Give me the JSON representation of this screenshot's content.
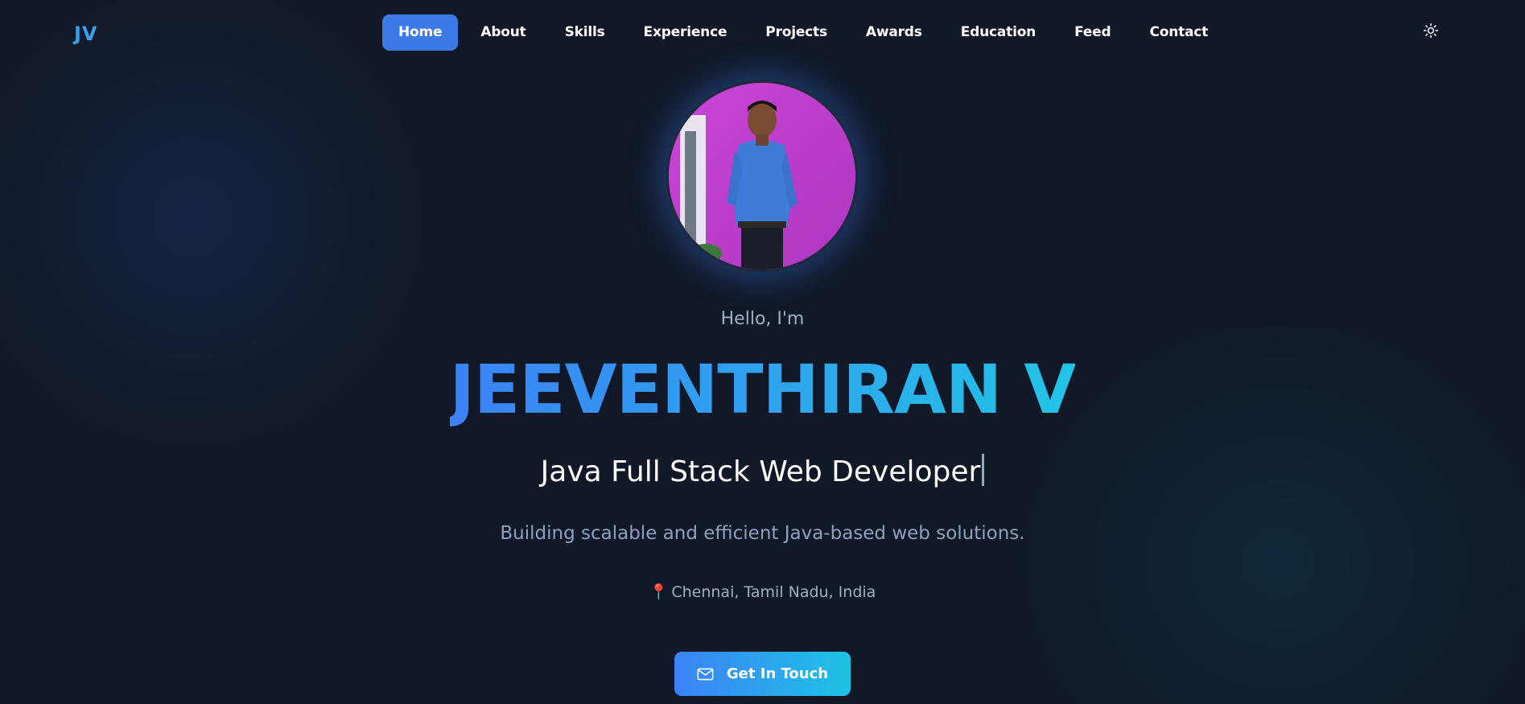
{
  "nav": {
    "logo": "JV",
    "items": [
      {
        "label": "Home",
        "active": true
      },
      {
        "label": "About"
      },
      {
        "label": "Skills"
      },
      {
        "label": "Experience"
      },
      {
        "label": "Projects"
      },
      {
        "label": "Awards"
      },
      {
        "label": "Education"
      },
      {
        "label": "Feed"
      },
      {
        "label": "Contact"
      }
    ],
    "theme_icon": "sun-icon"
  },
  "hero": {
    "avatar_icon": "profile-photo",
    "greeting": "Hello, I'm",
    "name": "JEEVENTHIRAN V",
    "role": "Java Full Stack Web Developer",
    "tagline": "Building scalable and efficient Java-based web solutions.",
    "location_icon": "pin-icon",
    "location": "Chennai, Tamil Nadu, India",
    "cta_label": "Get In Touch",
    "cta_icon": "mail-icon"
  },
  "colors": {
    "background": "#111828",
    "accent": "#3b7be8",
    "name_gradient_start": "#3b82f6",
    "name_gradient_end": "#22c4e6"
  }
}
